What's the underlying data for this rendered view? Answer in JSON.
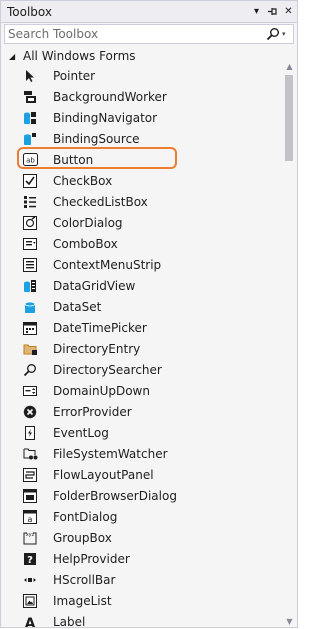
{
  "window": {
    "title": "Toolbox",
    "dropdown_glyph": "▾",
    "pin_glyph": "⊣",
    "close_glyph": "✕"
  },
  "search": {
    "placeholder": "Search Toolbox",
    "icon": "search-icon"
  },
  "group": {
    "label": "All Windows Forms",
    "expanded": true
  },
  "items": [
    {
      "label": "Pointer",
      "icon": "pointer-icon"
    },
    {
      "label": "BackgroundWorker",
      "icon": "backgroundworker-icon"
    },
    {
      "label": "BindingNavigator",
      "icon": "bindingnavigator-icon"
    },
    {
      "label": "BindingSource",
      "icon": "bindingsource-icon"
    },
    {
      "label": "Button",
      "icon": "button-icon",
      "highlighted": true
    },
    {
      "label": "CheckBox",
      "icon": "checkbox-icon"
    },
    {
      "label": "CheckedListBox",
      "icon": "checkedlistbox-icon"
    },
    {
      "label": "ColorDialog",
      "icon": "colordialog-icon"
    },
    {
      "label": "ComboBox",
      "icon": "combobox-icon"
    },
    {
      "label": "ContextMenuStrip",
      "icon": "contextmenustrip-icon"
    },
    {
      "label": "DataGridView",
      "icon": "datagridview-icon"
    },
    {
      "label": "DataSet",
      "icon": "dataset-icon"
    },
    {
      "label": "DateTimePicker",
      "icon": "datetimepicker-icon"
    },
    {
      "label": "DirectoryEntry",
      "icon": "directoryentry-icon"
    },
    {
      "label": "DirectorySearcher",
      "icon": "directorysearcher-icon"
    },
    {
      "label": "DomainUpDown",
      "icon": "domainupdown-icon"
    },
    {
      "label": "ErrorProvider",
      "icon": "errorprovider-icon"
    },
    {
      "label": "EventLog",
      "icon": "eventlog-icon"
    },
    {
      "label": "FileSystemWatcher",
      "icon": "filesystemwatcher-icon"
    },
    {
      "label": "FlowLayoutPanel",
      "icon": "flowlayoutpanel-icon"
    },
    {
      "label": "FolderBrowserDialog",
      "icon": "folderbrowserdialog-icon"
    },
    {
      "label": "FontDialog",
      "icon": "fontdialog-icon"
    },
    {
      "label": "GroupBox",
      "icon": "groupbox-icon"
    },
    {
      "label": "HelpProvider",
      "icon": "helpprovider-icon"
    },
    {
      "label": "HScrollBar",
      "icon": "hscrollbar-icon"
    },
    {
      "label": "ImageList",
      "icon": "imagelist-icon"
    },
    {
      "label": "Label",
      "icon": "label-icon"
    }
  ],
  "colors": {
    "highlight_border": "#ed7d31",
    "icon_dark": "#1e1e1e",
    "icon_blue": "#1ba1e2",
    "icon_orange": "#c27d1a"
  }
}
